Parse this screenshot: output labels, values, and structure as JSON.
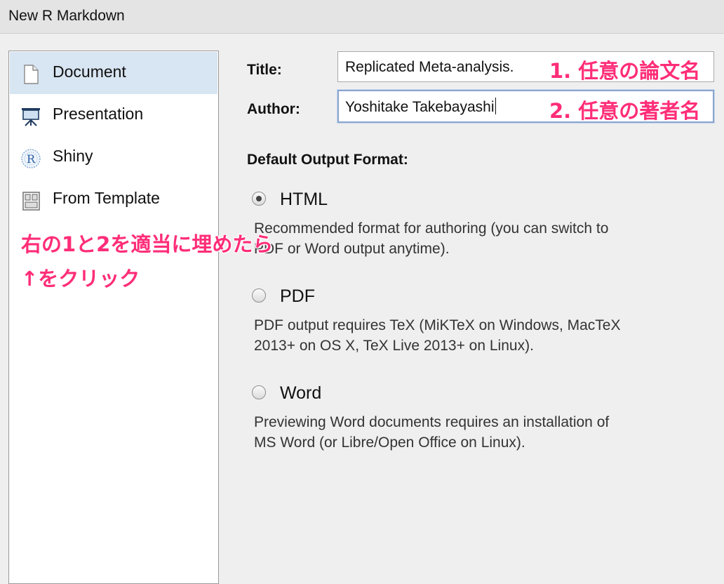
{
  "window": {
    "title": "New R Markdown"
  },
  "sidebar": {
    "items": [
      {
        "label": "Document",
        "icon": "document-icon",
        "selected": true
      },
      {
        "label": "Presentation",
        "icon": "presentation-icon",
        "selected": false
      },
      {
        "label": "Shiny",
        "icon": "shiny-r-icon",
        "selected": false
      },
      {
        "label": "From Template",
        "icon": "template-icon",
        "selected": false
      }
    ]
  },
  "form": {
    "title_label": "Title:",
    "title_value": "Replicated Meta-analysis.",
    "author_label": "Author:",
    "author_value": "Yoshitake Takebayashi",
    "output_heading": "Default Output Format:",
    "options": [
      {
        "label": "HTML",
        "selected": true,
        "description_line1": "Recommended format for authoring (you can switch to",
        "description_line2": "PDF or Word output anytime)."
      },
      {
        "label": "PDF",
        "selected": false,
        "description_line1": "PDF output requires TeX (MiKTeX on Windows, MacTeX",
        "description_line2": "2013+ on OS X, TeX Live 2013+ on Linux)."
      },
      {
        "label": "Word",
        "selected": false,
        "description_line1": "Previewing Word documents requires an installation of",
        "description_line2": "MS Word (or Libre/Open Office on Linux)."
      }
    ]
  },
  "annotations": {
    "title_note": "1. 任意の論文名",
    "author_note": "2. 任意の著者名",
    "instruction_line1": "右の1と2を適当に埋めたら",
    "instruction_line2": "↑をクリック",
    "color": "#ff2d78"
  },
  "colors": {
    "selected_row": "#d8e5f2",
    "focus_border": "#8aa6cf"
  }
}
